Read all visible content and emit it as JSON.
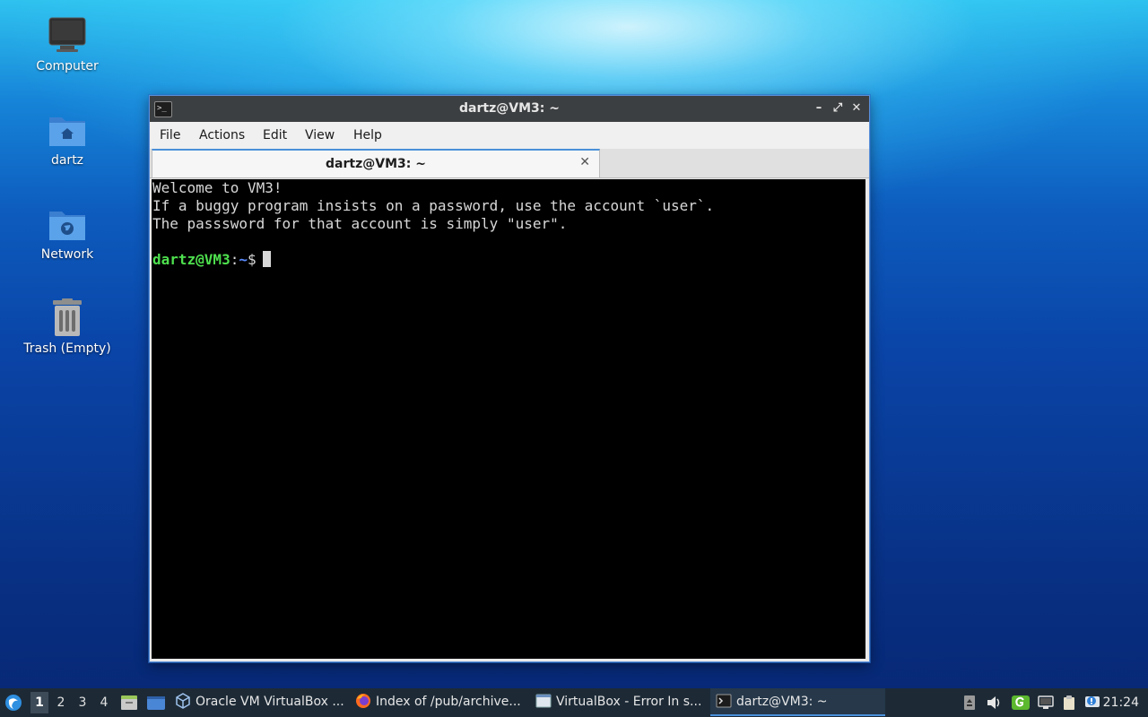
{
  "desktop": {
    "icons": [
      {
        "label": "Computer",
        "icon": "computer-icon"
      },
      {
        "label": "dartz",
        "icon": "home-folder-icon"
      },
      {
        "label": "Network",
        "icon": "network-folder-icon"
      },
      {
        "label": "Trash (Empty)",
        "icon": "trash-icon"
      }
    ]
  },
  "window": {
    "title": "dartz@VM3: ~",
    "controls": {
      "minimize": "–",
      "maximize": "⤢",
      "close": "✕"
    },
    "menu": [
      "File",
      "Actions",
      "Edit",
      "View",
      "Help"
    ],
    "tab": {
      "label": "dartz@VM3: ~",
      "close": "✕"
    }
  },
  "terminal": {
    "lines": [
      "Welcome to VM3!",
      "If a buggy program insists on a password, use the account `user`.",
      "The passsword for that account is simply \"user\"."
    ],
    "prompt_user": "dartz@VM3",
    "prompt_colon": ":",
    "prompt_path": "~",
    "prompt_symbol": "$"
  },
  "taskbar": {
    "workspaces": [
      "1",
      "2",
      "3",
      "4"
    ],
    "active_workspace": "1",
    "tasks": [
      {
        "label": "Oracle VM VirtualBox ...",
        "icon": "virtualbox-icon",
        "active": false
      },
      {
        "label": "Index of /pub/archive...",
        "icon": "firefox-icon",
        "active": false
      },
      {
        "label": "VirtualBox - Error In s...",
        "icon": "window-icon",
        "active": false
      },
      {
        "label": "dartz@VM3: ~",
        "icon": "terminal-icon",
        "active": true
      }
    ],
    "clock": "21:24"
  }
}
